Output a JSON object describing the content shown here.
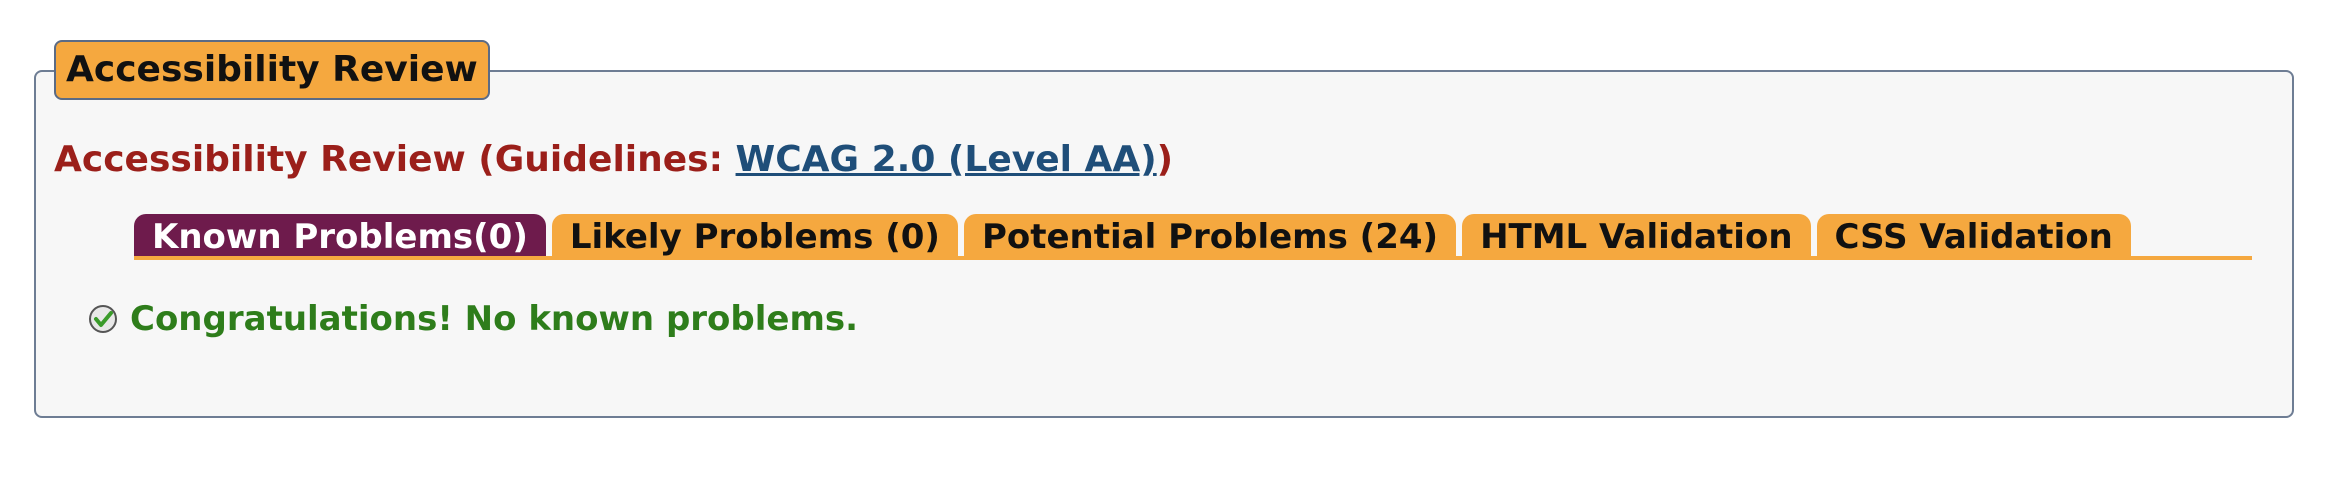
{
  "panel": {
    "legend": "Accessibility Review"
  },
  "review": {
    "heading_prefix": "Accessibility Review (Guidelines: ",
    "guideline_link": "WCAG 2.0 (Level AA)",
    "heading_suffix": ")"
  },
  "tabs": [
    {
      "label": "Known Problems(0)",
      "active": true
    },
    {
      "label": "Likely Problems (0)",
      "active": false
    },
    {
      "label": "Potential Problems (24)",
      "active": false
    },
    {
      "label": "HTML Validation",
      "active": false
    },
    {
      "label": "CSS Validation",
      "active": false
    }
  ],
  "result": {
    "icon": "check-circle-icon",
    "message": "Congratulations! No known problems."
  },
  "colors": {
    "tab_orange": "#f5a83f",
    "tab_active": "#6e1b4c",
    "heading_red": "#9b1f1a",
    "link_blue": "#1f4e79",
    "success_green": "#2e7d1b"
  }
}
